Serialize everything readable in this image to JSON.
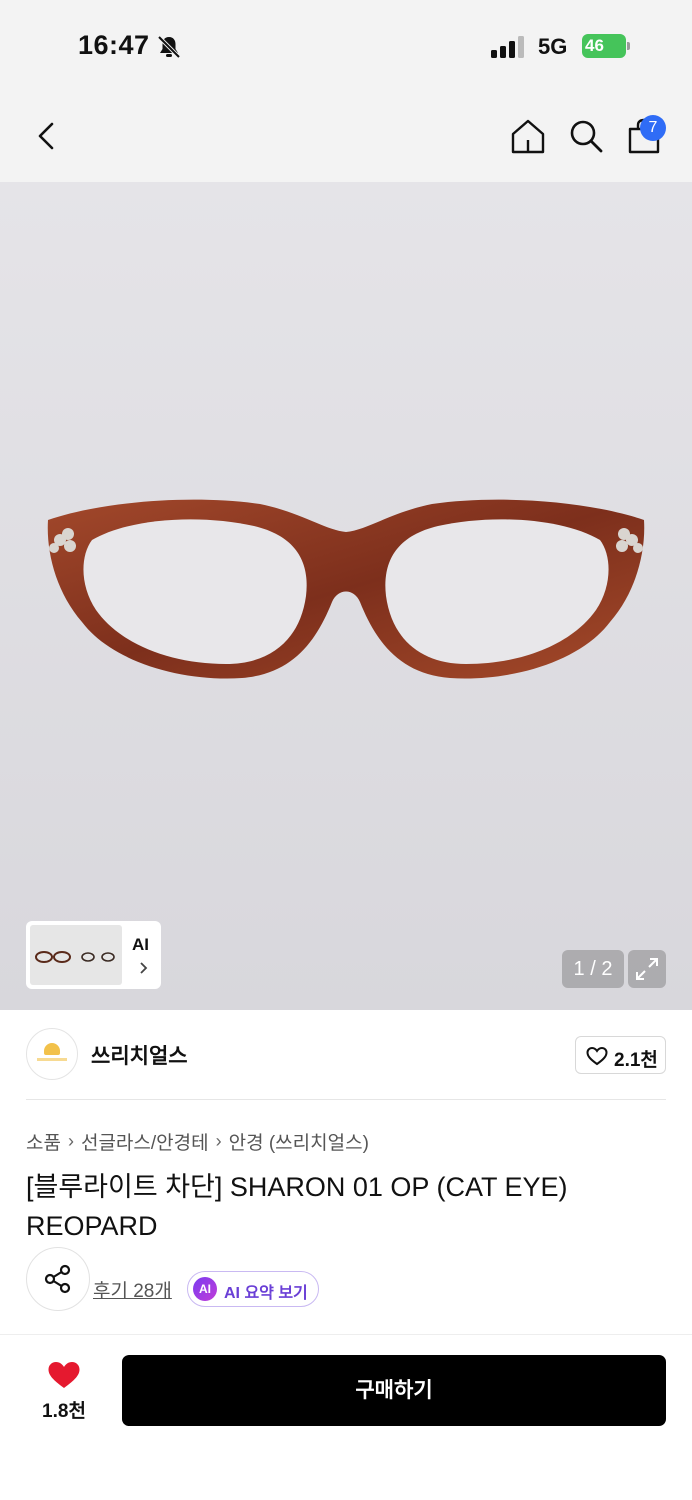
{
  "status_bar": {
    "time": "16:47",
    "network": "5G",
    "battery": "46"
  },
  "header": {
    "cart_badge": "7"
  },
  "gallery": {
    "page_indicator": "1 / 2",
    "ai_label": "AI"
  },
  "brand": {
    "name": "쓰리치얼스",
    "like_count": "2.1천"
  },
  "breadcrumb": [
    "소품",
    "선글라스/안경테",
    "안경 (쓰리치얼스)"
  ],
  "product": {
    "title": "[블루라이트 차단] SHARON 01 OP (CAT EYE) REOPARD",
    "review_link": "후기 28개",
    "ai_summary_chip": "AI",
    "ai_summary_label": "AI 요약 보기"
  },
  "bottom_bar": {
    "wish_count": "1.8천",
    "buy_label": "구매하기"
  },
  "colors": {
    "accent_blue": "#2f6cf6",
    "heart_red": "#e5192f",
    "ai_purple": "#6a3fd6",
    "frame_tortoise": "#8a3a22"
  }
}
